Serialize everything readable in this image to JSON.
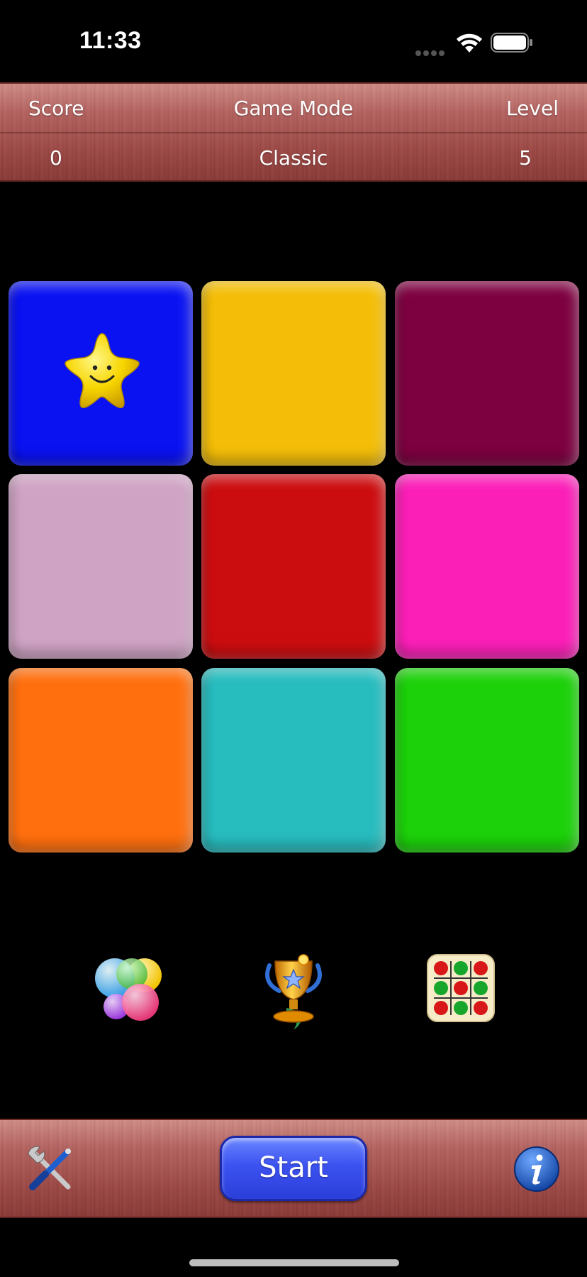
{
  "status_bar": {
    "time": "11:33"
  },
  "header": {
    "score_label": "Score",
    "mode_label": "Game Mode",
    "level_label": "Level",
    "score_value": "0",
    "mode_value": "Classic",
    "level_value": "5"
  },
  "tiles": [
    {
      "color": "#0a12f2",
      "has_star": true
    },
    {
      "color": "#f4be08"
    },
    {
      "color": "#7d0040"
    },
    {
      "color": "#cfa3c4"
    },
    {
      "color": "#cc0d10"
    },
    {
      "color": "#fb1fb8"
    },
    {
      "color": "#ff6f0e"
    },
    {
      "color": "#27bcbe"
    },
    {
      "color": "#1cd10a"
    }
  ],
  "icons": {
    "left": "game-center-icon",
    "center": "trophy-icon",
    "right": "board-icon"
  },
  "footer": {
    "start_label": "Start"
  }
}
